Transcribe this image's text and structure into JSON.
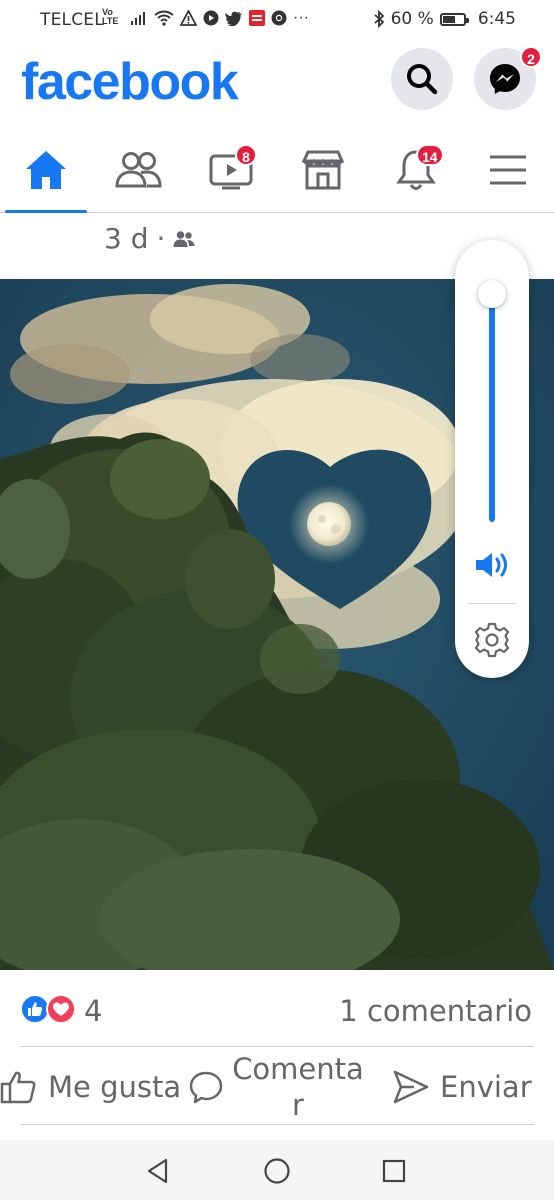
{
  "status_bar": {
    "carrier": "TELCEL",
    "volte_top": "Vo",
    "volte_bottom": "LTE",
    "battery_percent": "60 %",
    "battery_level": 0.6,
    "time": "6:45",
    "more": "···"
  },
  "header": {
    "logo": "facebook",
    "brand_color": "#1877f2",
    "messenger_badge": "2"
  },
  "tabs": [
    {
      "name": "home",
      "icon": "home-icon",
      "active": true
    },
    {
      "name": "friends",
      "icon": "friends-icon"
    },
    {
      "name": "watch",
      "icon": "video-icon",
      "badge": "8"
    },
    {
      "name": "marketplace",
      "icon": "store-icon"
    },
    {
      "name": "notifications",
      "icon": "bell-icon",
      "badge": "14"
    },
    {
      "name": "menu",
      "icon": "hamburger-icon"
    }
  ],
  "post": {
    "time": "3 d",
    "separator": "·",
    "audience_icon": "friends-audience-icon",
    "reaction_count": "4",
    "comment_count": "1 comentario",
    "like_label": "Me gusta",
    "comment_label": "Comentar",
    "send_label": "Enviar"
  },
  "volume": {
    "level": 0.95,
    "speaker_icon": "speaker-icon",
    "settings_icon": "gear-icon"
  },
  "system_nav": [
    "back-icon",
    "home-circle-icon",
    "recents-icon"
  ]
}
